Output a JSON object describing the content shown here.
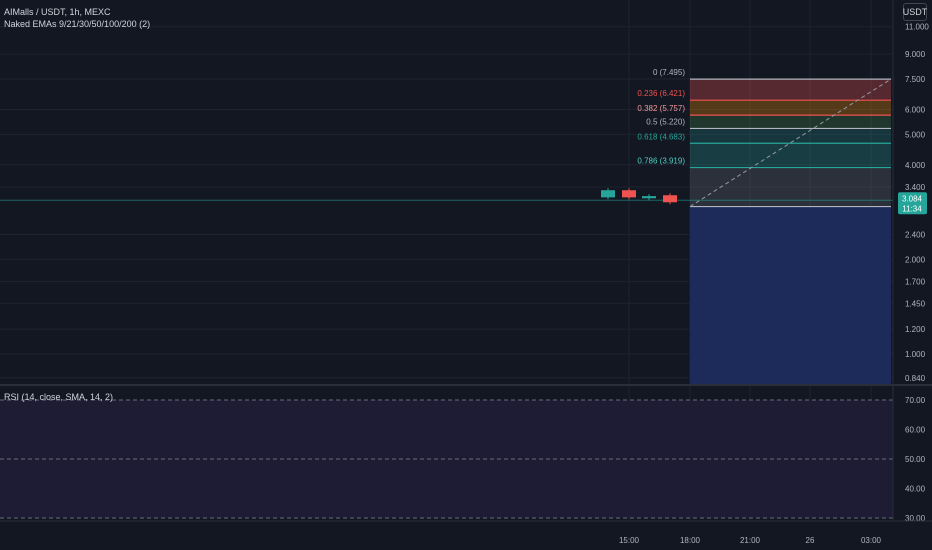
{
  "symbol_title": "AIMalls / USDT, 1h, MEXC",
  "indicator_label": "Naked EMAs 9/21/30/50/100/200 (2)",
  "rsi_label": "RSI (14, close, SMA, 14, 2)",
  "currency_button": "USDT",
  "price_badge": {
    "price": "3.084",
    "countdown": "11:34"
  },
  "colors": {
    "background": "#131722",
    "up": "#26a69a",
    "down": "#ef5350",
    "fib_teal": "#26a69a",
    "fib_red": "#ef5350",
    "rsi_band": "#1e1b35",
    "projection": "#1c2b5a"
  },
  "chart_data": {
    "type": "candlestick",
    "price_axis": {
      "scale": "log",
      "ticks": [
        "11.000",
        "9.000",
        "7.500",
        "6.000",
        "5.000",
        "4.000",
        "3.400",
        "2.400",
        "2.000",
        "1.700",
        "1.450",
        "1.200",
        "1.000",
        "0.840"
      ]
    },
    "time_axis": {
      "ticks": [
        "15:00",
        "18:00",
        "21:00",
        "26",
        "03:00"
      ]
    },
    "candles": [
      {
        "open": 3.15,
        "close": 3.32
      },
      {
        "open": 3.32,
        "close": 3.15
      },
      {
        "open": 3.13,
        "close": 3.18
      },
      {
        "open": 3.2,
        "close": 3.04
      }
    ],
    "last_price": 3.084,
    "fib_levels": [
      {
        "ratio": "0",
        "value": 7.495,
        "label": "0 (7.495)"
      },
      {
        "ratio": "0.236",
        "value": 6.421,
        "label": "0.236 (6.421)"
      },
      {
        "ratio": "0.382",
        "value": 5.757,
        "label": "0.382 (5.757)"
      },
      {
        "ratio": "0.5",
        "value": 5.22,
        "label": "0.5 (5.220)"
      },
      {
        "ratio": "0.618",
        "value": 4.683,
        "label": "0.618 (4.683)"
      },
      {
        "ratio": "0.786",
        "value": 3.919,
        "label": "0.786 (3.919)"
      },
      {
        "ratio": "1",
        "value": 2.945,
        "label": ""
      }
    ],
    "rsi": {
      "ticks": [
        "70.00",
        "60.00",
        "50.00",
        "40.00",
        "30.00"
      ],
      "bands": [
        70,
        50,
        30
      ]
    }
  }
}
